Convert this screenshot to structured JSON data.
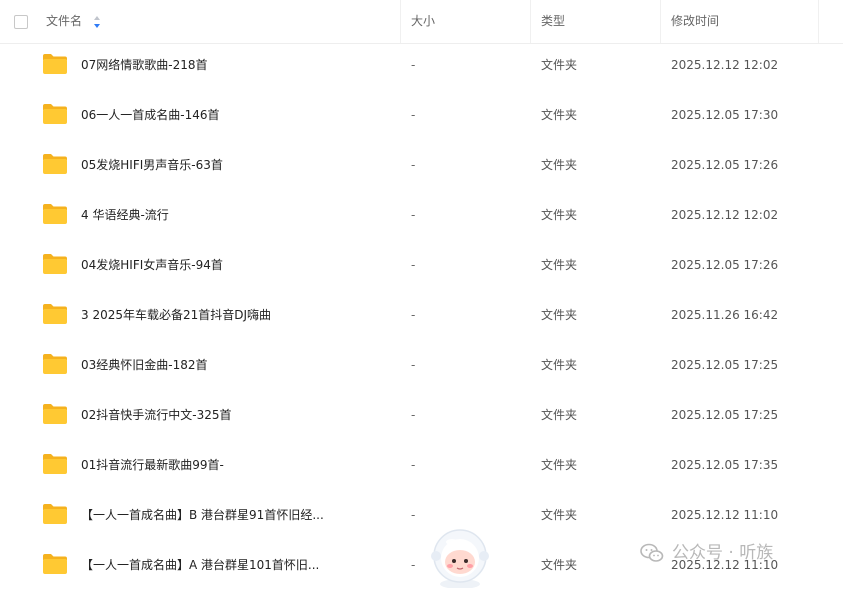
{
  "columns": {
    "name": "文件名",
    "size": "大小",
    "type": "类型",
    "time": "修改时间"
  },
  "rows": [
    {
      "name": "07网络情歌歌曲-218首",
      "size": "-",
      "type": "文件夹",
      "time": "2025.12.12 12:02"
    },
    {
      "name": "06一人一首成名曲-146首",
      "size": "-",
      "type": "文件夹",
      "time": "2025.12.05 17:30"
    },
    {
      "name": "05发烧HIFI男声音乐-63首",
      "size": "-",
      "type": "文件夹",
      "time": "2025.12.05 17:26"
    },
    {
      "name": "4 华语经典-流行",
      "size": "-",
      "type": "文件夹",
      "time": "2025.12.12 12:02"
    },
    {
      "name": "04发烧HIFI女声音乐-94首",
      "size": "-",
      "type": "文件夹",
      "time": "2025.12.05 17:26"
    },
    {
      "name": "3 2025年车载必备21首抖音DJ嗨曲",
      "size": "-",
      "type": "文件夹",
      "time": "2025.11.26 16:42"
    },
    {
      "name": "03经典怀旧金曲-182首",
      "size": "-",
      "type": "文件夹",
      "time": "2025.12.05 17:25"
    },
    {
      "name": "02抖音快手流行中文-325首",
      "size": "-",
      "type": "文件夹",
      "time": "2025.12.05 17:25"
    },
    {
      "name": "01抖音流行最新歌曲99首-",
      "size": "-",
      "type": "文件夹",
      "time": "2025.12.05 17:35"
    },
    {
      "name": "【一人一首成名曲】B 港台群星91首怀旧经...",
      "size": "-",
      "type": "文件夹",
      "time": "2025.12.12 11:10"
    },
    {
      "name": "【一人一首成名曲】A 港台群星101首怀旧...",
      "size": "-",
      "type": "文件夹",
      "time": "2025.12.12 11:10"
    }
  ],
  "watermark": {
    "text": "公众号 · 听族",
    "icon": "wechat-icon"
  },
  "icons": {
    "folder": "folder-icon",
    "sort": "sort-icon",
    "mascot": "astronaut-mascot"
  },
  "colors": {
    "folder": "#FFC933",
    "folder_tab": "#F5B21E",
    "sort_active": "#2F7BF6",
    "header_text": "#666666",
    "watermark": "#B8B8B8"
  }
}
